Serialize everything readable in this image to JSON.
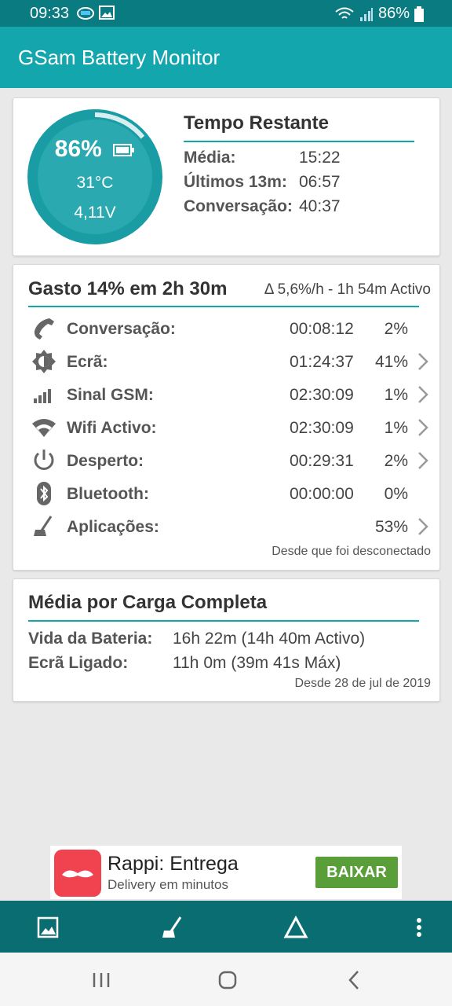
{
  "status_bar": {
    "time": "09:33",
    "battery": "86%",
    "icons": [
      "vpn-icon",
      "image-icon",
      "wifi-icon",
      "signal-icon",
      "battery-icon"
    ]
  },
  "app_bar": {
    "title": "GSam Battery Monitor"
  },
  "battery_card": {
    "percent": "86%",
    "percent_value": 86,
    "temperature": "31°C",
    "voltage": "4,11V",
    "title": "Tempo Restante",
    "rows": [
      {
        "label": "Média:",
        "value": "15:22"
      },
      {
        "label": "Últimos 13m:",
        "value": "06:57"
      },
      {
        "label": "Conversação:",
        "value": "40:37"
      }
    ]
  },
  "usage_card": {
    "title": "Gasto 14% em 2h 30m",
    "subtitle": "Δ 5,6%/h - 1h 54m Activo",
    "items": [
      {
        "icon": "phone-icon",
        "label": "Conversação:",
        "time": "00:08:12",
        "percent": "2%",
        "has_chevron": false
      },
      {
        "icon": "brightness-icon",
        "label": "Ecrã:",
        "time": "01:24:37",
        "percent": "41%",
        "has_chevron": true
      },
      {
        "icon": "signal-bars-icon",
        "label": "Sinal GSM:",
        "time": "02:30:09",
        "percent": "1%",
        "has_chevron": true
      },
      {
        "icon": "wifi-icon",
        "label": "Wifi Activo:",
        "time": "02:30:09",
        "percent": "1%",
        "has_chevron": true
      },
      {
        "icon": "power-icon",
        "label": "Desperto:",
        "time": "00:29:31",
        "percent": "2%",
        "has_chevron": true
      },
      {
        "icon": "bluetooth-icon",
        "label": "Bluetooth:",
        "time": "00:00:00",
        "percent": "0%",
        "has_chevron": false
      },
      {
        "icon": "broom-icon",
        "label": "Aplicações:",
        "time": "",
        "percent": "53%",
        "has_chevron": true
      }
    ],
    "footer": "Desde que foi desconectado"
  },
  "average_card": {
    "title": "Média por Carga Completa",
    "rows": [
      {
        "label": "Vida da Bateria:",
        "value": "16h 22m (14h 40m Activo)"
      },
      {
        "label": "Ecrã Ligado:",
        "value": "11h 0m (39m 41s Máx)"
      }
    ],
    "footer": "Desde 28 de jul de 2019"
  },
  "ad": {
    "title": "Rappi: Entrega",
    "subtitle": "Delivery em minutos",
    "button": "BAIXAR"
  },
  "bottom_bar": {
    "buttons": [
      "image-icon",
      "broom-icon",
      "delta-icon",
      "more-vert-icon"
    ]
  },
  "nav_bar": {
    "buttons": [
      "recents-icon",
      "home-icon",
      "back-icon"
    ]
  },
  "colors": {
    "status_bar": "#0a7b80",
    "app_bar": "#13a6ad",
    "accent": "#13a6ad",
    "gauge_fill": "#2aa9b0",
    "gauge_ring": "#199ca3",
    "bottom_bar": "#0a6d72",
    "ad_button": "#5a9e3a"
  }
}
